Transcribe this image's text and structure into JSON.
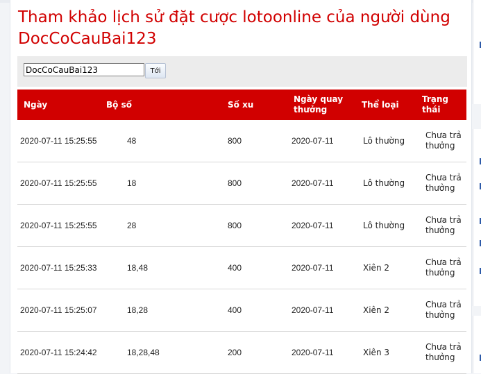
{
  "page": {
    "title": "Tham khảo lịch sử đặt cược lotoonline của người dùng DocCoCauBai123"
  },
  "search": {
    "value": "DocCoCauBai123",
    "button_label": "Tới"
  },
  "table": {
    "headers": [
      "Ngày",
      "Bộ số",
      "Số xu",
      "Ngày quay thưởng",
      "Thể loại",
      "Trạng thái"
    ],
    "rows": [
      [
        "2020-07-11 15:25:55",
        "48",
        "800",
        "2020-07-11",
        "Lô thường",
        "Chưa trả thưởng"
      ],
      [
        "2020-07-11 15:25:55",
        "18",
        "800",
        "2020-07-11",
        "Lô thường",
        "Chưa trả thưởng"
      ],
      [
        "2020-07-11 15:25:55",
        "28",
        "800",
        "2020-07-11",
        "Lô thường",
        "Chưa trả thưởng"
      ],
      [
        "2020-07-11 15:25:33",
        "18,48",
        "400",
        "2020-07-11",
        "Xiên 2",
        "Chưa trả thưởng"
      ],
      [
        "2020-07-11 15:25:07",
        "18,28",
        "400",
        "2020-07-11",
        "Xiên 2",
        "Chưa trả thưởng"
      ],
      [
        "2020-07-11 15:24:42",
        "18,28,48",
        "200",
        "2020-07-11",
        "Xiên 3",
        "Chưa trả thưởng"
      ]
    ]
  },
  "colors": {
    "accent": "#d10000",
    "header_text": "#ffffff",
    "row_border": "#d6d6d6"
  }
}
